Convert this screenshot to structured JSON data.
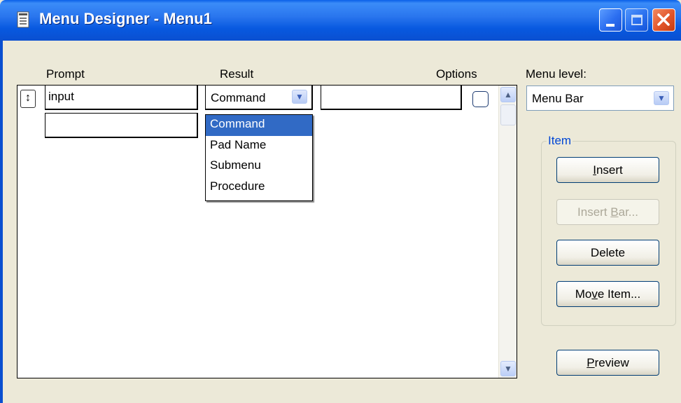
{
  "window": {
    "title": "Menu Designer - Menu1",
    "icon": "menu-designer-icon"
  },
  "headers": {
    "prompt": "Prompt",
    "result": "Result",
    "options": "Options",
    "menu_level": "Menu level:"
  },
  "rows": [
    {
      "prompt": "input",
      "result": "Command",
      "value": ""
    },
    {
      "prompt": ""
    }
  ],
  "result_dropdown": {
    "selected": "Command",
    "options": [
      "Command",
      "Pad Name",
      "Submenu",
      "Procedure"
    ]
  },
  "menu_level": {
    "value": "Menu Bar"
  },
  "item_group": {
    "legend": "Item",
    "insert": {
      "pre": "",
      "key": "I",
      "post": "nsert"
    },
    "insert_bar": {
      "pre": "Insert ",
      "key": "B",
      "post": "ar..."
    },
    "delete": {
      "pre": "Delete",
      "key": "",
      "post": ""
    },
    "move_item": {
      "pre": "Mo",
      "key": "v",
      "post": "e Item..."
    }
  },
  "preview": {
    "pre": "",
    "key": "P",
    "post": "review"
  },
  "colors": {
    "titlebar": "#0a5fe8",
    "face": "#ece9d8",
    "selection": "#316ac5",
    "group_legend": "#0046d5"
  }
}
